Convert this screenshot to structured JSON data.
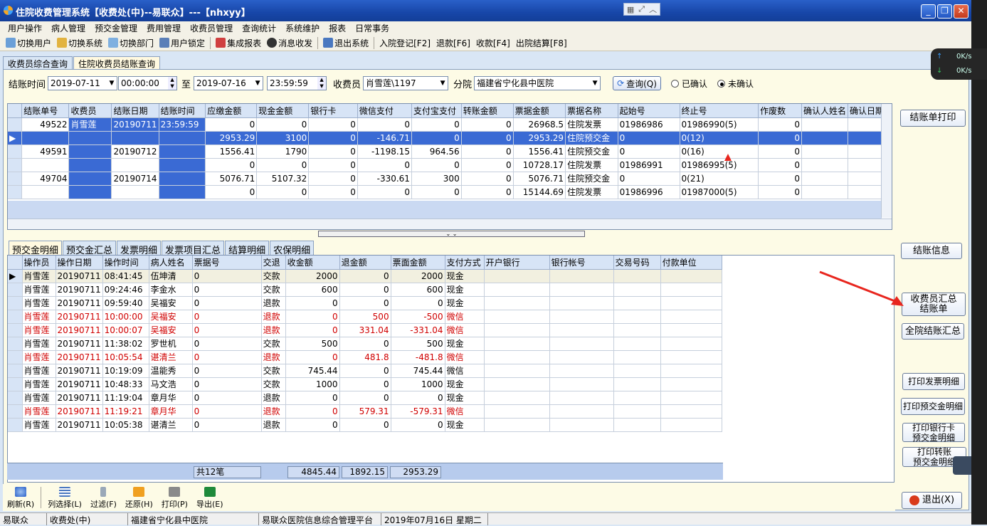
{
  "window": {
    "title": "住院收费管理系统【收费处(中)--易联众】---【nhxyy】"
  },
  "menu": [
    "用户操作",
    "病人管理",
    "预交金管理",
    "费用管理",
    "收费员管理",
    "查询统计",
    "系统维护",
    "报表",
    "日常事务"
  ],
  "toolbar": [
    "切换用户",
    "切换系统",
    "切换部门",
    "用户锁定",
    "集成报表",
    "消息收发",
    "退出系统",
    "入院登记[F2]",
    "退款[F6]",
    "收款[F4]",
    "出院结算[F8]"
  ],
  "tabs": [
    "收费员综合查询",
    "住院收费员结账查询"
  ],
  "query": {
    "time_label": "结账时间",
    "date_from": "2019-07-11",
    "time_from": "00:00:00",
    "to_label": "至",
    "date_to": "2019-07-16",
    "time_to": "23:59:59",
    "cashier_label": "收费员",
    "cashier": "肖雪莲\\1197",
    "branch_label": "分院",
    "branch": "福建省宁化县中医院",
    "query_btn": "查询(Q)",
    "radio_confirmed": "已确认",
    "radio_unconfirmed": "未确认"
  },
  "grid1": {
    "headers": [
      "结账单号",
      "收费员",
      "结账日期",
      "结账时间",
      "应缴金额",
      "现金金额",
      "银行卡",
      "微信支付",
      "支付宝支付",
      "转账金额",
      "票据金额",
      "票据名称",
      "起始号",
      "终止号",
      "作废数",
      "确认人姓名",
      "确认日期"
    ],
    "rows": [
      [
        "49522",
        "肖雪莲",
        "20190711",
        "23:59:59",
        "0",
        "0",
        "0",
        "0",
        "0",
        "0",
        "26968.5",
        "住院发票",
        "01986986",
        "01986990(5)",
        "0",
        "",
        ""
      ],
      [
        "",
        "",
        "",
        "",
        "2953.29",
        "3100",
        "0",
        "-146.71",
        "0",
        "0",
        "2953.29",
        "住院预交金",
        "0",
        "0(12)",
        "0",
        "",
        ""
      ],
      [
        "49591",
        "",
        "20190712",
        "",
        "1556.41",
        "1790",
        "0",
        "-1198.15",
        "964.56",
        "0",
        "1556.41",
        "住院预交金",
        "0",
        "0(16)",
        "0",
        "",
        ""
      ],
      [
        "",
        "",
        "",
        "",
        "0",
        "0",
        "0",
        "0",
        "0",
        "0",
        "10728.17",
        "住院发票",
        "01986991",
        "01986995(5)",
        "0",
        "",
        ""
      ],
      [
        "49704",
        "",
        "20190714",
        "",
        "5076.71",
        "5107.32",
        "0",
        "-330.61",
        "300",
        "0",
        "5076.71",
        "住院预交金",
        "0",
        "0(21)",
        "0",
        "",
        ""
      ],
      [
        "",
        "",
        "",
        "",
        "0",
        "0",
        "0",
        "0",
        "0",
        "0",
        "15144.69",
        "住院发票",
        "01986996",
        "01987000(5)",
        "0",
        "",
        ""
      ]
    ]
  },
  "tabs2": [
    "预交金明细",
    "预交金汇总",
    "发票明细",
    "发票项目汇总",
    "结算明细",
    "农保明细"
  ],
  "grid2": {
    "headers": [
      "操作员",
      "操作日期",
      "操作时间",
      "病人姓名",
      "票据号",
      "交退",
      "收金额",
      "退金额",
      "票面金额",
      "支付方式",
      "开户银行",
      "银行帐号",
      "交易号码",
      "付款单位"
    ],
    "rows": [
      [
        "肖雪莲",
        "20190711",
        "08:41:45",
        "伍坤清",
        "0",
        "交款",
        "2000",
        "0",
        "2000",
        "现金"
      ],
      [
        "肖雪莲",
        "20190711",
        "09:24:46",
        "李金水",
        "0",
        "交款",
        "600",
        "0",
        "600",
        "现金"
      ],
      [
        "肖雪莲",
        "20190711",
        "09:59:40",
        "吴福安",
        "0",
        "退款",
        "0",
        "0",
        "0",
        "现金"
      ],
      [
        "肖雪莲",
        "20190711",
        "10:00:00",
        "吴福安",
        "0",
        "退款",
        "0",
        "500",
        "-500",
        "微信"
      ],
      [
        "肖雪莲",
        "20190711",
        "10:00:07",
        "吴福安",
        "0",
        "退款",
        "0",
        "331.04",
        "-331.04",
        "微信"
      ],
      [
        "肖雪莲",
        "20190711",
        "11:38:02",
        "罗世机",
        "0",
        "交款",
        "500",
        "0",
        "500",
        "现金"
      ],
      [
        "肖雪莲",
        "20190711",
        "10:05:54",
        "谌清兰",
        "0",
        "退款",
        "0",
        "481.8",
        "-481.8",
        "微信"
      ],
      [
        "肖雪莲",
        "20190711",
        "10:19:09",
        "温能秀",
        "0",
        "交款",
        "745.44",
        "0",
        "745.44",
        "微信"
      ],
      [
        "肖雪莲",
        "20190711",
        "10:48:33",
        "马文浩",
        "0",
        "交款",
        "1000",
        "0",
        "1000",
        "现金"
      ],
      [
        "肖雪莲",
        "20190711",
        "11:19:04",
        "章月华",
        "0",
        "退款",
        "0",
        "0",
        "0",
        "现金"
      ],
      [
        "肖雪莲",
        "20190711",
        "11:19:21",
        "章月华",
        "0",
        "退款",
        "0",
        "579.31",
        "-579.31",
        "微信"
      ],
      [
        "肖雪莲",
        "20190711",
        "10:05:38",
        "谌清兰",
        "0",
        "退款",
        "0",
        "0",
        "0",
        "现金"
      ]
    ],
    "red_rows": [
      3,
      4,
      6,
      10
    ],
    "summary": {
      "count": "共12笔",
      "in": "4845.44",
      "out": "1892.15",
      "face": "2953.29"
    }
  },
  "bottom_toolbar": [
    "刷新(R)",
    "列选择(L)",
    "过滤(F)",
    "还原(H)",
    "打印(P)",
    "导出(E)"
  ],
  "right_buttons": {
    "print_bill": "结账单打印",
    "bill_info": "结账信息",
    "summary_l1": "收费员汇总",
    "summary_l2": "结账单",
    "hospital_summary": "全院结账汇总",
    "print_invoice": "打印发票明细",
    "print_prepay": "打印预交金明细",
    "print_bank_l1": "打印银行卡",
    "print_bank_l2": "预交金明细",
    "print_transfer_l1": "打印转账",
    "print_transfer_l2": "预交金明细",
    "exit": "退出(X)"
  },
  "status": [
    "易联众",
    "收费处(中)",
    "福建省宁化县中医院",
    "易联众医院信息综合管理平台",
    "2019年07月16日 星期二"
  ],
  "network": {
    "up": "0K/s",
    "down": "0K/s"
  }
}
